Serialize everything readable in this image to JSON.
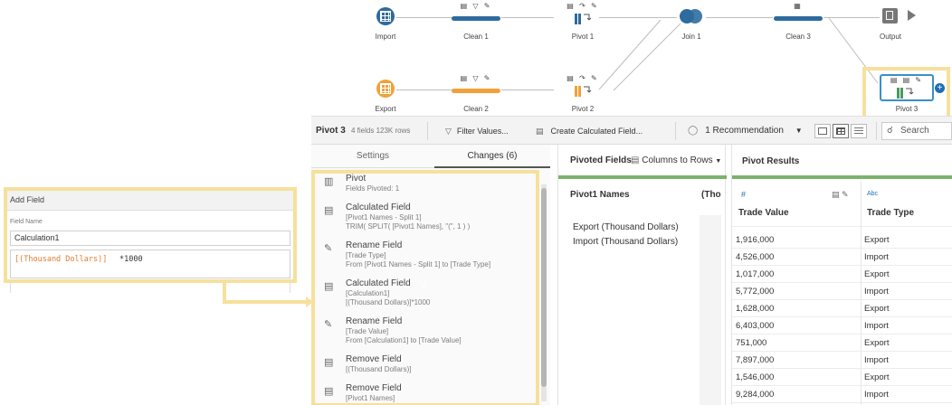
{
  "flow": {
    "nodes": {
      "import": "Import",
      "clean1": "Clean 1",
      "pivot1": "Pivot 1",
      "join1": "Join 1",
      "clean3": "Clean 3",
      "output": "Output",
      "export": "Export",
      "clean2": "Clean 2",
      "pivot2": "Pivot 2",
      "pivot3": "Pivot 3"
    },
    "colors": {
      "blue": "#2e6b9e",
      "orange": "#f0a13a",
      "teal": "#1b6f86"
    }
  },
  "toolbar": {
    "step_name": "Pivot 3",
    "meta": "4 fields  123K rows",
    "filter": "Filter Values...",
    "calc": "Create Calculated Field...",
    "recommendation": "1 Recommendation",
    "search": "Search"
  },
  "left": {
    "tab_settings": "Settings",
    "tab_changes": "Changes (6)",
    "changes": [
      {
        "title": "Pivot",
        "lines": [
          "Fields Pivoted: 1"
        ]
      },
      {
        "title": "Calculated Field",
        "lines": [
          "[Pivot1 Names - Split 1]",
          "TRIM( SPLIT( [Pivot1 Names], \"(\", 1 ) )"
        ]
      },
      {
        "title": "Rename Field",
        "lines": [
          "[Trade Type]",
          "From [Pivot1 Names - Split 1] to [Trade Type]"
        ]
      },
      {
        "title": "Calculated Field",
        "lines": [
          "[Calculation1]",
          "[(Thousand Dollars)]*1000"
        ]
      },
      {
        "title": "Rename Field",
        "lines": [
          "[Trade Value]",
          "From [Calculation1] to [Trade Value]"
        ]
      },
      {
        "title": "Remove Field",
        "lines": [
          "[(Thousand Dollars)]"
        ]
      },
      {
        "title": "Remove Field",
        "lines": [
          "[Pivot1 Names]"
        ]
      }
    ],
    "cursor_glyph": "V"
  },
  "middle": {
    "header": "Pivoted Fields",
    "mode": "Columns to Rows",
    "col_header": "Pivot1 Names",
    "col2_header": "(Tho",
    "values": [
      "Export (Thousand Dollars)",
      "Import (Thousand Dollars)"
    ]
  },
  "results": {
    "header": "Pivot Results",
    "col1_type": "#",
    "col1": "Trade Value",
    "col2_type": "Abc",
    "col2": "Trade Type",
    "rows": [
      [
        "1,916,000",
        "Export"
      ],
      [
        "4,526,000",
        "Import"
      ],
      [
        "1,017,000",
        "Export"
      ],
      [
        "5,772,000",
        "Import"
      ],
      [
        "1,628,000",
        "Export"
      ],
      [
        "6,403,000",
        "Import"
      ],
      [
        "751,000",
        "Export"
      ],
      [
        "7,897,000",
        "Import"
      ],
      [
        "1,546,000",
        "Export"
      ],
      [
        "9,284,000",
        "Import"
      ]
    ]
  },
  "dialog": {
    "title": "Add Field",
    "field_label": "Field Name",
    "field_value": "Calculation1",
    "formula_field": "[(Thousand Dollars)]",
    "formula_rest": "*1000"
  }
}
